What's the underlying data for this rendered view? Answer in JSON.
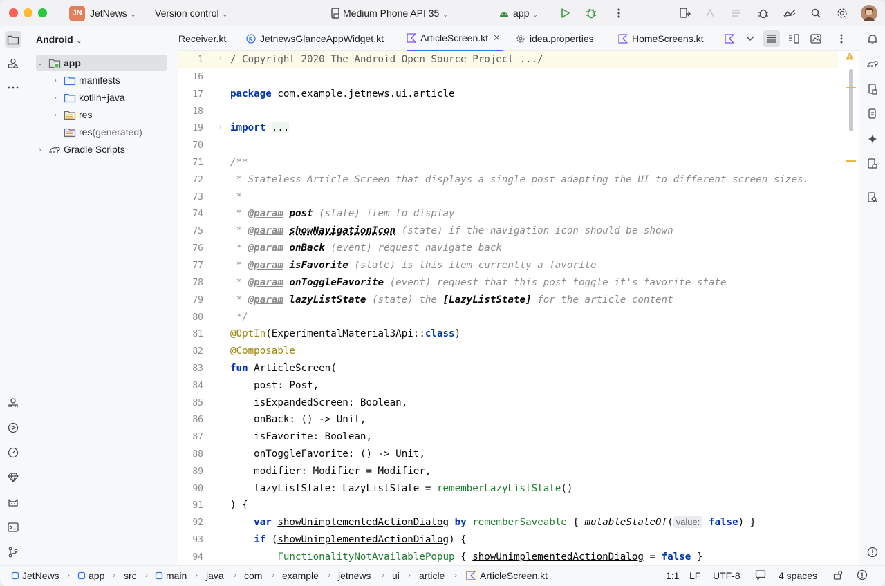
{
  "titlebar": {
    "project_badge": "JN",
    "project_name": "JetNews",
    "vcs": "Version control",
    "device": "Medium Phone API 35",
    "run_config": "app"
  },
  "project_panel": {
    "view": "Android",
    "tree": [
      {
        "label": "app",
        "suffix": ""
      },
      {
        "label": "manifests",
        "suffix": ""
      },
      {
        "label": "kotlin+java",
        "suffix": ""
      },
      {
        "label": "res",
        "suffix": ""
      },
      {
        "label": "res",
        "suffix": " (generated)"
      },
      {
        "label": "Gradle Scripts",
        "suffix": ""
      }
    ]
  },
  "tabs": [
    {
      "label": "Receiver.kt"
    },
    {
      "label": "JetnewsGlanceAppWidget.kt"
    },
    {
      "label": "ArticleScreen.kt"
    },
    {
      "label": "idea.properties"
    },
    {
      "label": "HomeScreens.kt"
    }
  ],
  "editor": {
    "line_numbers": [
      "1",
      "16",
      "17",
      "18",
      "19",
      "70",
      "71",
      "72",
      "73",
      "74",
      "75",
      "76",
      "77",
      "78",
      "79",
      "80",
      "81",
      "82",
      "83",
      "84",
      "85",
      "86",
      "87",
      "88",
      "89",
      "90",
      "91",
      "92",
      "93",
      "94"
    ],
    "l1": "/ Copyright 2020 The Android Open Source Project .../",
    "l17_kw": "package",
    "l17_rest": " com.example.jetnews.ui.article",
    "l19_kw": "import",
    "l19_fold": "...",
    "l71": "/**",
    "l72": " * Stateless Article Screen that displays a single post adapting the UI to different screen sizes.",
    "l73": " *",
    "params": [
      {
        "tag": "@param",
        "name": "post",
        "desc": " (state) item to display"
      },
      {
        "tag": "@param",
        "name": "showNavigationIcon",
        "desc": " (state) if the navigation icon should be shown"
      },
      {
        "tag": "@param",
        "name": "onBack",
        "desc": " (event) request navigate back"
      },
      {
        "tag": "@param",
        "name": "isFavorite",
        "desc": " (state) is this item currently a favorite"
      },
      {
        "tag": "@param",
        "name": "onToggleFavorite",
        "desc": " (event) request that this post toggle it's favorite state"
      },
      {
        "tag": "@param",
        "name": "lazyListState",
        "desc_pre": " (state) the ",
        "link": "[LazyListState]",
        "desc": " for the article content"
      }
    ],
    "l80": " */",
    "l81_ann": "@OptIn",
    "l81_mid": "(ExperimentalMaterial3Api::",
    "l81_kw": "class",
    "l81_end": ")",
    "l82_ann": "@Composable",
    "l83_kw": "fun",
    "l83_rest": " ArticleScreen(",
    "l84": "    post: Post,",
    "l85": "    isExpandedScreen: Boolean,",
    "l86": "    onBack: () -> Unit,",
    "l87": "    isFavorite: Boolean,",
    "l88": "    onToggleFavorite: () -> Unit,",
    "l89": "    modifier: Modifier = Modifier,",
    "l90_pre": "    lazyListState: LazyListState = ",
    "l90_call": "rememberLazyListState",
    "l90_end": "()",
    "l91": ") {",
    "l92_kw": "var",
    "l92_var": "showUnimplementedActionDialog",
    "l92_by": "by",
    "l92_call": "rememberSaveable",
    "l92_brace": " { ",
    "l92_fn": "mutableStateOf",
    "l92_hint": "value:",
    "l92_false": "false",
    "l92_end": ") }",
    "l93_kw": "if",
    "l93_var": "showUnimplementedActionDialog",
    "l93_end": ") {",
    "l94_call": "FunctionalityNotAvailablePopup",
    "l94_brace": " { ",
    "l94_var": "showUnimplementedActionDialog",
    "l94_eq": " = ",
    "l94_false": "false",
    "l94_end": " }"
  },
  "statusbar": {
    "breadcrumbs": [
      "JetNews",
      "app",
      "src",
      "main",
      "java",
      "com",
      "example",
      "jetnews",
      "ui",
      "article",
      "ArticleScreen.kt"
    ],
    "position": "1:1",
    "line_sep": "LF",
    "encoding": "UTF-8",
    "indent": "4 spaces"
  },
  "colors": {
    "accent": "#3574f0",
    "keyword": "#0033b3",
    "comment": "#8c8c8c",
    "annotation": "#9e880d",
    "function_call": "#1c7e2e",
    "warning": "#e8b64a"
  }
}
